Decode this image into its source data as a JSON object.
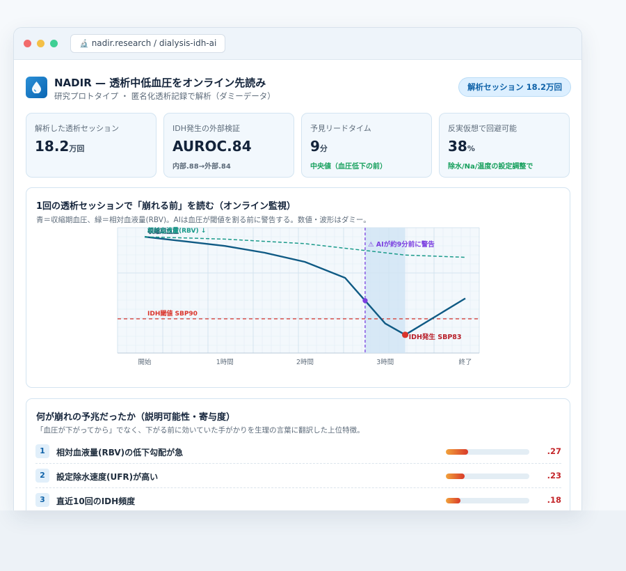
{
  "browser": {
    "url": "nadir.research / dialysis-idh-ai"
  },
  "header": {
    "title": "NADIR — 透析中低血圧をオンライン先読み",
    "subtitle": "研究プロトタイプ ・ 匿名化透析記録で解析（ダミーデータ）",
    "session_badge": "解析セッション 18.2万回"
  },
  "stats": [
    {
      "label": "解析した透析セッション",
      "value": "18.2",
      "unit": "万回",
      "note": ""
    },
    {
      "label": "IDH発生の外部検証",
      "value": "AUROC.84",
      "unit": "",
      "note": "内部.88→外部.84"
    },
    {
      "label": "予見リードタイム",
      "value": "9",
      "unit": "分",
      "note": "中央値（血圧低下の前）"
    },
    {
      "label": "反実仮想で回避可能",
      "value": "38",
      "unit": "%",
      "note": "除水/Na/温度の設定調整で"
    }
  ],
  "monitor": {
    "title": "1回の透析セッションで「崩れる前」を読む（オンライン監視）",
    "subtitle": "青＝収縮期血圧、緑＝相対血液量(RBV)。AIは血圧が閾値を割る前に警告する。数値・波形はダミー。"
  },
  "chart_data": {
    "type": "line",
    "x": [
      0,
      0.5,
      1,
      1.5,
      2,
      2.5,
      2.75,
      3,
      3.25,
      4
    ],
    "xticks": [
      "開始",
      "1時間",
      "2時間",
      "3時間",
      "終了"
    ],
    "xtick_positions": [
      0,
      1,
      2,
      3,
      4
    ],
    "xlim": [
      0,
      4
    ],
    "ylim": [
      75,
      130
    ],
    "series": [
      {
        "name": "収縮期血圧",
        "color": "#0f5a84",
        "style": "solid",
        "values": [
          126,
          124,
          122,
          119,
          115,
          108,
          98,
          88,
          83,
          99
        ]
      },
      {
        "name": "相対血液量(RBV) ↓",
        "color": "#1a9a8a",
        "style": "dashed",
        "values": [
          126,
          125.5,
          125,
          124,
          123,
          121,
          120,
          119,
          118,
          117
        ]
      }
    ],
    "threshold": {
      "label": "IDH閾値 SBP90",
      "value": 90,
      "color": "#d9342b"
    },
    "alert": {
      "label": "⚠ AIが約9分前に警告",
      "x": 2.75,
      "color": "#7b3fe0"
    },
    "window": {
      "x_start": 2.75,
      "x_end": 3.25
    },
    "event": {
      "label": "IDH発生 SBP83",
      "x": 3.25,
      "y": 83,
      "color": "#d9342b"
    }
  },
  "features": {
    "title": "何が崩れの予兆だったか（説明可能性・寄与度）",
    "subtitle": "「血圧が下がってから」でなく、下がる前に効いていた手がかりを生理の言葉に翻訳した上位特徴。",
    "items": [
      {
        "rank": "1",
        "label": "相対血液量(RBV)の低下勾配が急",
        "score": ".27",
        "value": 0.27
      },
      {
        "rank": "2",
        "label": "設定除水速度(UFR)が高い",
        "score": ".23",
        "value": 0.23
      },
      {
        "rank": "3",
        "label": "直近10回のIDH頻度",
        "score": ".18",
        "value": 0.18
      }
    ]
  }
}
